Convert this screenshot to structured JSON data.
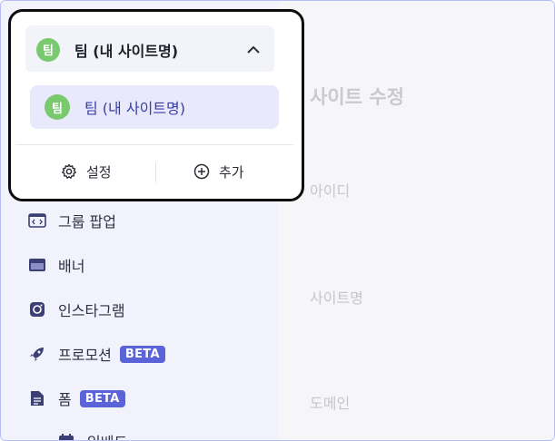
{
  "team_switcher": {
    "avatar_letter": "팀",
    "current_team": "팀 (내 사이트명)",
    "toggle_icon": "chevron-up-icon"
  },
  "team_menu": {
    "items": [
      {
        "avatar_letter": "팀",
        "name": "팀 (내 사이트명)"
      }
    ],
    "settings_label": "설정",
    "add_label": "추가"
  },
  "sidebar": {
    "items": [
      {
        "label": "그룹 팝업",
        "icon": "code-window-icon"
      },
      {
        "label": "배너",
        "icon": "banner-icon"
      },
      {
        "label": "인스타그램",
        "icon": "instagram-icon"
      },
      {
        "label": "프로모션",
        "icon": "rocket-icon",
        "badge": "BETA"
      },
      {
        "label": "폼",
        "icon": "document-icon",
        "badge": "BETA"
      },
      {
        "label": "임베드",
        "icon": "calendar-icon"
      }
    ]
  },
  "main": {
    "title": "사이트 수정",
    "fields": [
      {
        "label": "아이디"
      },
      {
        "label": "사이트명"
      },
      {
        "label": "도메인"
      }
    ]
  },
  "colors": {
    "accent": "#5b63d8",
    "avatar_green": "#79c96e",
    "selected_bg": "#e8eafc"
  }
}
